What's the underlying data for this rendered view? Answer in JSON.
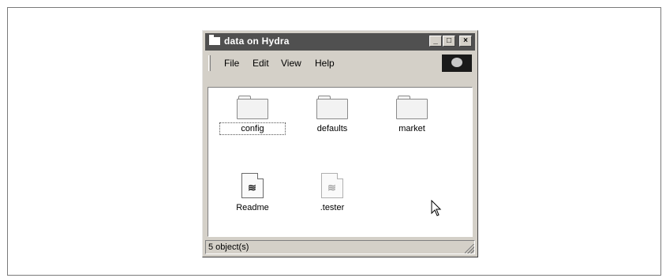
{
  "window": {
    "title": "data on Hydra",
    "buttons": {
      "minimize": "_",
      "maximize": "□",
      "close": "×"
    }
  },
  "menu": {
    "items": [
      {
        "label": "File"
      },
      {
        "label": "Edit"
      },
      {
        "label": "View"
      },
      {
        "label": "Help"
      }
    ],
    "throbber_icon": "windows-logo-icon"
  },
  "files": [
    {
      "name": "config",
      "type": "folder",
      "icon": "folder-icon"
    },
    {
      "name": "defaults",
      "type": "folder",
      "icon": "folder-icon"
    },
    {
      "name": "market",
      "type": "folder",
      "icon": "folder-icon"
    },
    {
      "name": "Readme",
      "type": "document",
      "icon": "document-icon"
    },
    {
      "name": ".tester",
      "type": "document-hidden",
      "icon": "document-icon"
    }
  ],
  "status": {
    "text": "5 object(s)"
  }
}
